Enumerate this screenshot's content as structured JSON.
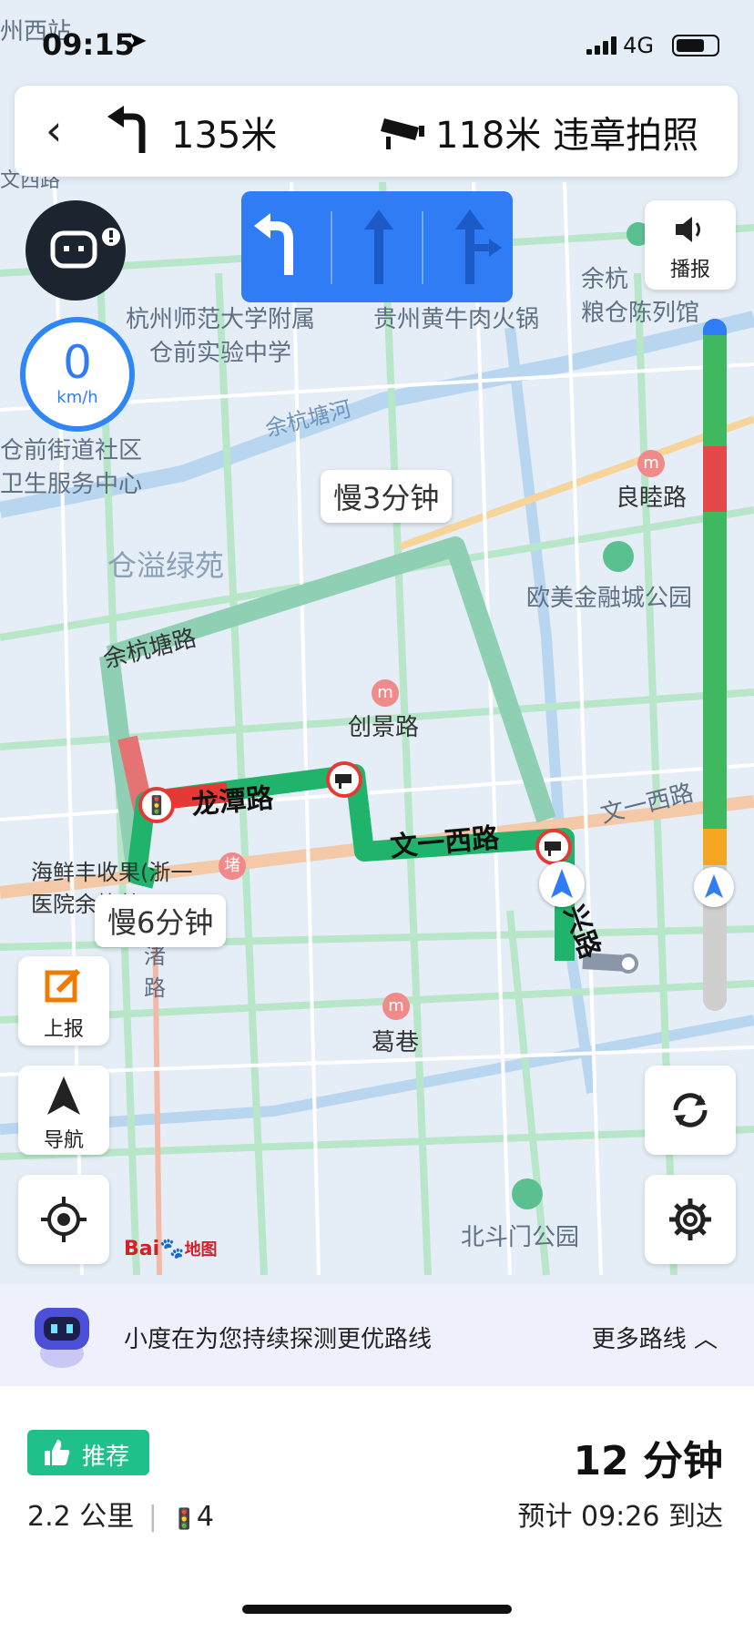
{
  "status_bar": {
    "time": "09:15",
    "network": "4G"
  },
  "nav_header": {
    "turn_distance": "135米",
    "camera_distance": "118米",
    "camera_label": "违章拍照"
  },
  "lanes": [
    "left-turn",
    "straight",
    "straight-right"
  ],
  "speed": {
    "value": "0",
    "unit": "km/h"
  },
  "broadcast_label": "播报",
  "route_bubbles": {
    "slow1": "慢3分钟",
    "slow2": "慢6分钟"
  },
  "map_labels": {
    "top_left_station": "州西站",
    "top_left_road": "文西路",
    "school": "杭州师范大学附属\n仓前实验中学",
    "restaurant": "贵州黄牛肉火锅",
    "museum": "余杭\n粮仓陈列馆",
    "health_center": "仓前街道社区\n卫生服务中心",
    "river": "余杭塘河",
    "liangmu": "良睦路",
    "garden": "仓溢绿苑",
    "park_finance": "欧美金融城公园",
    "yuhang_road": "余杭塘路",
    "chuangjing": "创景路",
    "longtan": "龙潭路",
    "wenyi_west": "文一西路",
    "wenyi_west2": "文一西路",
    "hospital": "海鲜丰收果(浙一\n医院余杭总",
    "xing_road": "兴路",
    "zhu_road": "渚\n路",
    "gexiang": "葛巷",
    "beidou": "北斗门公园",
    "metro_sym": "m",
    "du_sym": "堵"
  },
  "side_buttons": {
    "report": "上报",
    "navigate": "导航"
  },
  "baidu_logo": {
    "a": "Bai",
    "b": "地图"
  },
  "xiaodu": {
    "message": "小度在为您持续探测更优路线",
    "more_routes": "更多路线"
  },
  "route_summary": {
    "badge": "推荐",
    "duration": "12 分钟",
    "distance": "2.2 公里",
    "lights": "4",
    "eta": "预计 09:26 到达"
  },
  "colors": {
    "route_green": "#1fb36b",
    "route_faded": "#8fd0b4",
    "congested": "#e53935",
    "accent_blue": "#2f7cf4"
  }
}
